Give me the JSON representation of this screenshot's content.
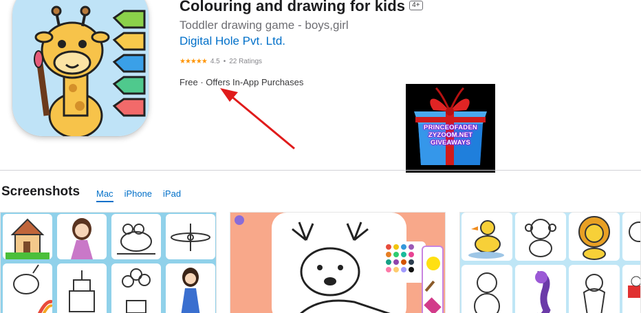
{
  "app": {
    "title": "Colouring and drawing for kids",
    "age_rating": "4+",
    "subtitle": "Toddler drawing game - boys,girl",
    "developer": "Digital Hole Pvt. Ltd.",
    "stars": "★★★★★",
    "rating_value": "4.5",
    "rating_separator": "•",
    "rating_count": "22 Ratings",
    "price": "Free · Offers In-App Purchases"
  },
  "overlay": {
    "giveaway_line1": "PRINCEOFADEN",
    "giveaway_line2": "ZYZOOM.NET",
    "giveaway_line3": "GIVEAWAYS",
    "arrow_color": "#e01b1b"
  },
  "screenshots": {
    "heading": "Screenshots",
    "tabs": [
      {
        "label": "Mac",
        "active": true
      },
      {
        "label": "iPhone",
        "active": false
      },
      {
        "label": "iPad",
        "active": false
      }
    ]
  },
  "colors": {
    "link": "#0070c9",
    "star": "#ff9500",
    "divider": "#d2d2d7"
  }
}
